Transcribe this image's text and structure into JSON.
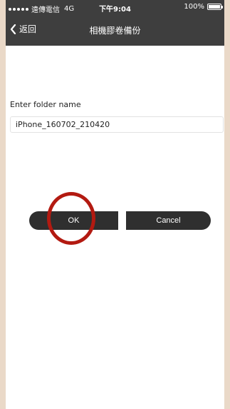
{
  "status_bar": {
    "carrier": "遠傳電信",
    "network": "4G",
    "time": "下午9:04",
    "battery": "100%"
  },
  "nav": {
    "back_label": "返回",
    "title": "相機膠卷備份"
  },
  "form": {
    "label": "Enter folder name",
    "folder_name_value": "iPhone_160702_210420"
  },
  "buttons": {
    "ok_label": "OK",
    "cancel_label": "Cancel"
  },
  "colors": {
    "header_bg": "#3e3e3e",
    "button_bg": "#2f2f2f",
    "highlight_ring": "#b31a11",
    "page_bg": "#ead9c8"
  }
}
